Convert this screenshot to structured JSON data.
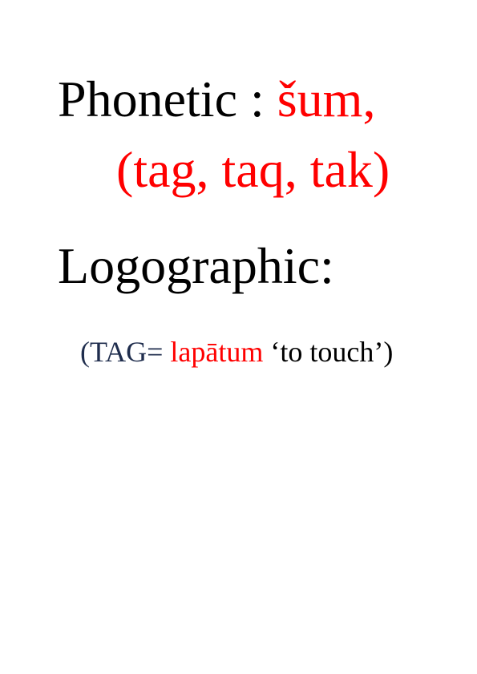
{
  "phonetic": {
    "label": "Phonetic : ",
    "reading_main": "šum,",
    "reading_alt": "(tag, taq, tak)"
  },
  "logographic": {
    "label": "Logographic:"
  },
  "example": {
    "open": "(TAG= ",
    "word": "lapātum",
    "gloss": " ‘to touch’)"
  },
  "colors": {
    "highlight": "#ff0000",
    "text": "#000000",
    "navy": "#1f2d4d"
  }
}
